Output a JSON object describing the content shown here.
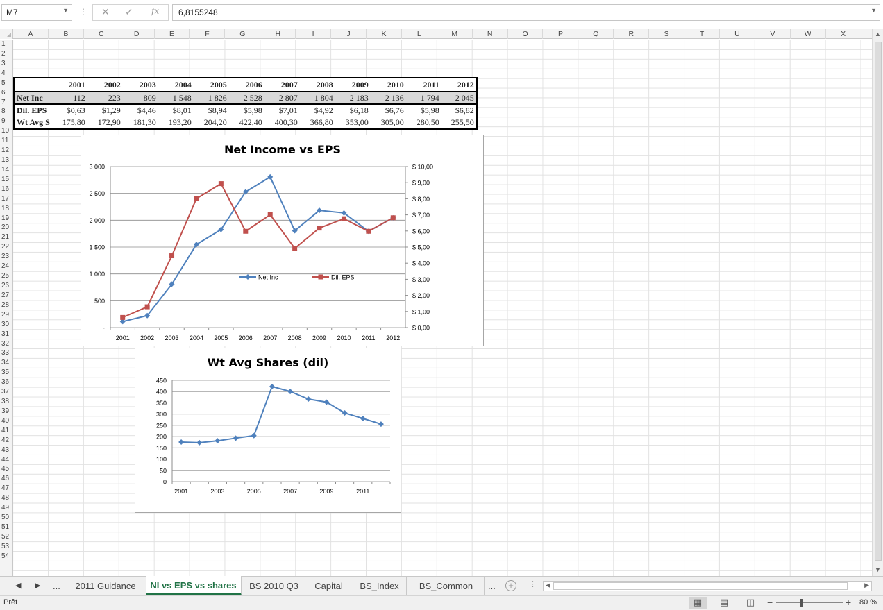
{
  "formula_bar": {
    "name_box": "M7",
    "formula": "6,8155248",
    "cancel_icon": "x-icon",
    "enter_icon": "check-icon",
    "fx_label": "fx"
  },
  "columns": [
    "A",
    "B",
    "C",
    "D",
    "E",
    "F",
    "G",
    "H",
    "I",
    "J",
    "K",
    "L",
    "M",
    "N",
    "O",
    "P",
    "Q",
    "R",
    "S",
    "T",
    "U",
    "V",
    "W",
    "X"
  ],
  "rows": [
    "1",
    "2",
    "3",
    "4",
    "5",
    "6",
    "7",
    "8",
    "9",
    "10",
    "11",
    "12",
    "13",
    "14",
    "15",
    "16",
    "17",
    "18",
    "19",
    "20",
    "21",
    "22",
    "23",
    "24",
    "25",
    "26",
    "27",
    "28",
    "29",
    "30",
    "31",
    "32",
    "33",
    "34",
    "35",
    "36",
    "37",
    "38",
    "39",
    "40",
    "41",
    "42",
    "43",
    "44",
    "45",
    "46",
    "47",
    "48",
    "49",
    "50",
    "51",
    "52",
    "53",
    "54"
  ],
  "table": {
    "years": [
      "2001",
      "2002",
      "2003",
      "2004",
      "2005",
      "2006",
      "2007",
      "2008",
      "2009",
      "2010",
      "2011",
      "2012"
    ],
    "rows": [
      {
        "label": "Net Inc",
        "values": [
          "112",
          "223",
          "809",
          "1 548",
          "1 826",
          "2 528",
          "2 807",
          "1 804",
          "2 183",
          "2 136",
          "1 794",
          "2 045"
        ]
      },
      {
        "label": "Dil. EPS",
        "values": [
          "$0,63",
          "$1,29",
          "$4,46",
          "$8,01",
          "$8,94",
          "$5,98",
          "$7,01",
          "$4,92",
          "$6,18",
          "$6,76",
          "$5,98",
          "$6,82"
        ]
      },
      {
        "label": "Wt Avg S",
        "values": [
          "175,80",
          "172,90",
          "181,30",
          "193,20",
          "204,20",
          "422,40",
          "400,30",
          "366,80",
          "353,00",
          "305,00",
          "280,50",
          "255,50"
        ]
      }
    ]
  },
  "chart_data": [
    {
      "type": "line",
      "title": "Net Income vs EPS",
      "categories": [
        "2001",
        "2002",
        "2003",
        "2004",
        "2005",
        "2006",
        "2007",
        "2008",
        "2009",
        "2010",
        "2011",
        "2012"
      ],
      "y_left_ticks": [
        "-",
        "500",
        "1 000",
        "1 500",
        "2 000",
        "2 500",
        "3 000"
      ],
      "y_right_ticks": [
        "$ 0,00",
        "$ 1,00",
        "$ 2,00",
        "$ 3,00",
        "$ 4,00",
        "$ 5,00",
        "$ 6,00",
        "$ 7,00",
        "$ 8,00",
        "$ 9,00",
        "$ 10,00"
      ],
      "ylim_left": [
        0,
        3000
      ],
      "ylim_right": [
        0,
        10
      ],
      "legend_position": "center",
      "grid": true,
      "series": [
        {
          "name": "Net Inc",
          "axis": "left",
          "color": "#4F81BD",
          "marker": "diamond",
          "values": [
            112,
            223,
            809,
            1548,
            1826,
            2528,
            2807,
            1804,
            2183,
            2136,
            1794,
            2045
          ]
        },
        {
          "name": "Dil. EPS",
          "axis": "right",
          "color": "#C0504D",
          "marker": "square",
          "values": [
            0.63,
            1.29,
            4.46,
            8.01,
            8.94,
            5.98,
            7.01,
            4.92,
            6.18,
            6.76,
            5.98,
            6.82
          ]
        }
      ]
    },
    {
      "type": "line",
      "title": "Wt Avg Shares (dil)",
      "categories": [
        "2001",
        "2002",
        "2003",
        "2004",
        "2005",
        "2006",
        "2007",
        "2008",
        "2009",
        "2010",
        "2011",
        "2012"
      ],
      "x_tick_labels": [
        "2001",
        "2003",
        "2005",
        "2007",
        "2009",
        "2011"
      ],
      "y_ticks": [
        "0",
        "50",
        "100",
        "150",
        "200",
        "250",
        "300",
        "350",
        "400",
        "450"
      ],
      "ylim": [
        0,
        450
      ],
      "grid": true,
      "series": [
        {
          "name": "Wt Avg Shares (dil)",
          "color": "#4F81BD",
          "marker": "diamond",
          "values": [
            175.8,
            172.9,
            181.3,
            193.2,
            204.2,
            422.4,
            400.3,
            366.8,
            353.0,
            305.0,
            280.5,
            255.5
          ]
        }
      ]
    }
  ],
  "sheet_tabs": {
    "ellipsis": "...",
    "tabs": [
      "2011 Guidance",
      "NI vs EPS vs shares",
      "BS 2010 Q3",
      "Capital",
      "BS_Index",
      "BS_Common"
    ],
    "active": "NI vs EPS vs shares"
  },
  "status": {
    "text": "Prêt",
    "zoom": "80 %",
    "zoom_minus": "−",
    "zoom_plus": "+"
  }
}
